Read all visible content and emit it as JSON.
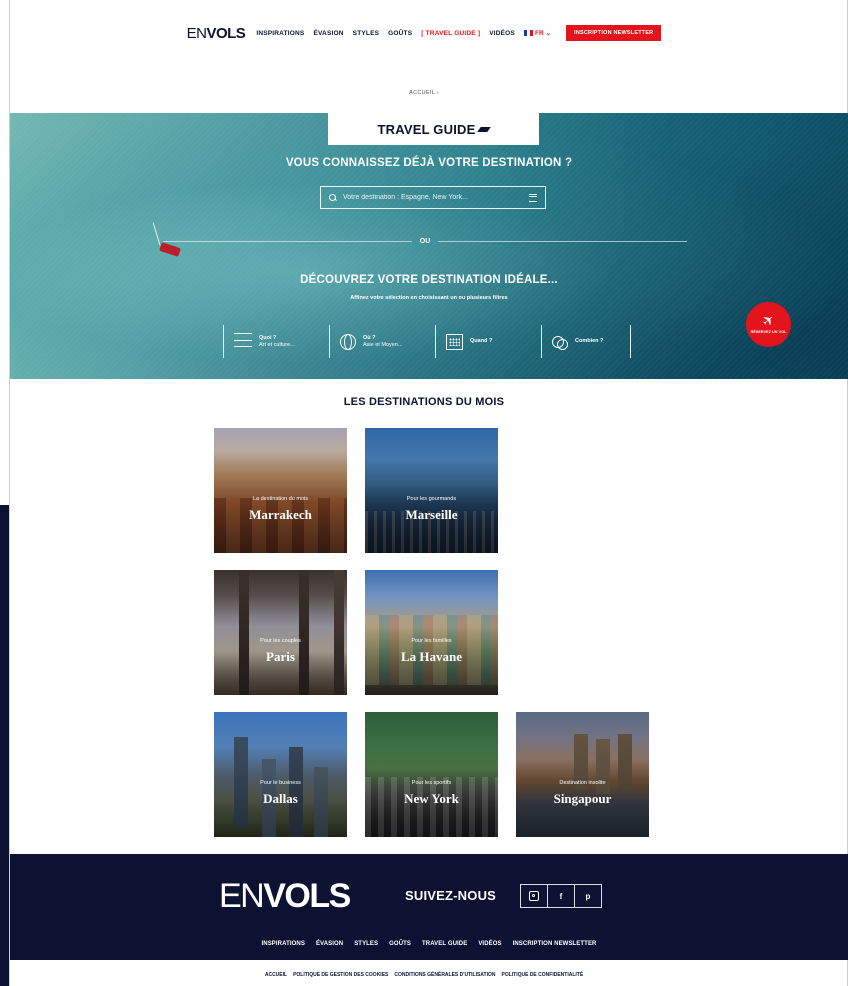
{
  "header": {
    "logo_pre": "EN",
    "logo_post": "VOLS",
    "nav": [
      "INSPIRATIONS",
      "ÉVASION",
      "STYLES",
      "GOÛTS",
      "[ TRAVEL GUIDE ]",
      "VIDÉOS"
    ],
    "lang": "FR",
    "newsletter_button": "INSCRIPTION NEWSLETTER"
  },
  "breadcrumb": "ACCUEIL  ›",
  "hero": {
    "title": "TRAVEL GUIDE",
    "question": "VOUS CONNAISSEZ DÉJÀ VOTRE DESTINATION ?",
    "search_placeholder": "Votre destination : Espagne, New York...",
    "or_text": "OU",
    "discover_title": "DÉCOUVREZ VOTRE DESTINATION IDÉALE...",
    "discover_subtitle": "Affinez votre sélection en choisissant un ou plusieurs filtres",
    "filters": [
      {
        "label": "Quoi ?",
        "sub": "Art et culture...",
        "icon": "lines-icon"
      },
      {
        "label": "Où ?",
        "sub": "Asie et Moyen...",
        "icon": "globe-icon"
      },
      {
        "label": "Quand ?",
        "sub": "",
        "icon": "calendar-icon"
      },
      {
        "label": "Combien ?",
        "sub": "",
        "icon": "coins-icon"
      }
    ],
    "book_badge": "RÉSERVEZ UN VOL"
  },
  "destinations": {
    "title": "LES DESTINATIONS DU MOIS",
    "cards": [
      {
        "category": "La destination du mois",
        "city": "Marrakech"
      },
      {
        "category": "Pour les gourmands",
        "city": "Marseille"
      },
      {
        "category": "Pour les couples",
        "city": "Paris"
      },
      {
        "category": "Pour les familles",
        "city": "La Havane"
      },
      {
        "category": "Pour le business",
        "city": "Dallas"
      },
      {
        "category": "Pour les sportifs",
        "city": "New York"
      },
      {
        "category": "Destination insolite",
        "city": "Singapour"
      }
    ]
  },
  "footer": {
    "logo_pre": "EN",
    "logo_post": "VOLS",
    "follow": "SUIVEZ-NOUS",
    "social": [
      "instagram-icon",
      "facebook-icon",
      "pinterest-icon"
    ],
    "social_glyphs": {
      "facebook": "f",
      "pinterest": "p"
    },
    "nav": [
      "INSPIRATIONS",
      "ÉVASION",
      "STYLES",
      "GOÛTS",
      "TRAVEL GUIDE",
      "VIDÉOS",
      "INSCRIPTION NEWSLETTER"
    ],
    "bottom_links": [
      "ACCUEIL",
      "POLITIQUE DE GESTION DES COOKIES",
      "CONDITIONS GÉNÉRALES D'UTILISATION",
      "POLITIQUE DE CONFIDENTIALITÉ"
    ]
  },
  "colors": {
    "navy": "#0d1232",
    "red": "#e3141b",
    "white": "#ffffff"
  }
}
